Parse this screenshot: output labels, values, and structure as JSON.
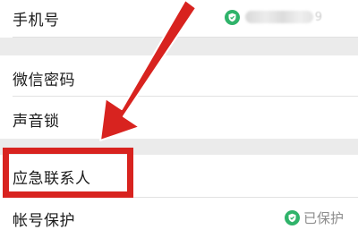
{
  "settings": {
    "rows": [
      {
        "label": "手机号"
      },
      {
        "label": "微信密码"
      },
      {
        "label": "声音锁"
      },
      {
        "label": "应急联系人"
      },
      {
        "label": "帐号保护"
      }
    ],
    "phone_status_tail": "9",
    "protect_status": "已保护"
  },
  "colors": {
    "accent_green": "#2fb36a",
    "highlight_red": "#d8231f"
  },
  "icons": [
    "shield-check-icon",
    "shield-check-icon",
    "red-arrow"
  ]
}
